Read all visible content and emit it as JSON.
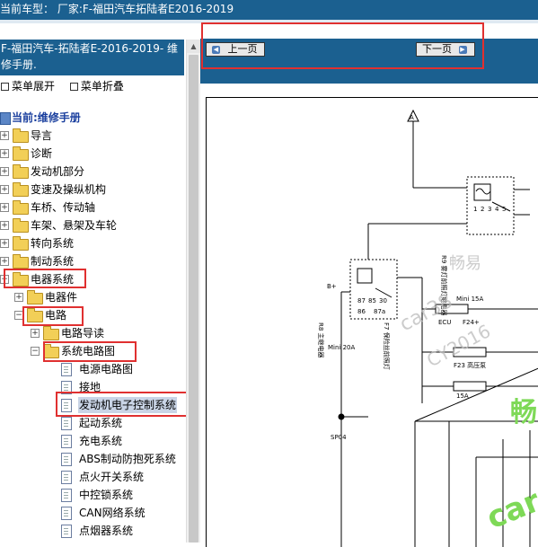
{
  "header": {
    "title": "当前车型：  厂家:F-福田汽车拓陆者E2016-2019"
  },
  "sidebar": {
    "book_title": "F-福田汽车-拓陆者E-2016-2019- 维修手册.",
    "expand_label": "菜单展开",
    "collapse_label": "菜单折叠",
    "current_label": "当前:维修手册",
    "items": [
      {
        "label": "导言"
      },
      {
        "label": "诊断"
      },
      {
        "label": "发动机部分"
      },
      {
        "label": "变速及操纵机构"
      },
      {
        "label": "车桥、传动轴"
      },
      {
        "label": "车架、悬架及车轮"
      },
      {
        "label": "转向系统"
      },
      {
        "label": "制动系统"
      },
      {
        "label": "电器系统"
      },
      {
        "label": "电器件"
      },
      {
        "label": "电路"
      },
      {
        "label": "电路导读"
      },
      {
        "label": "系统电路图"
      },
      {
        "label": "电源电路图"
      },
      {
        "label": "接地"
      },
      {
        "label": "发动机电子控制系统"
      },
      {
        "label": "起动系统"
      },
      {
        "label": "充电系统"
      },
      {
        "label": "ABS制动防抱死系统"
      },
      {
        "label": "点火开关系统"
      },
      {
        "label": "中控锁系统"
      },
      {
        "label": "CAN网络系统"
      },
      {
        "label": "点烟器系统"
      }
    ]
  },
  "nav": {
    "prev_label": "上一页",
    "next_label": "下一页"
  },
  "diagram": {
    "labels": {
      "r9": "R9 雾灯前照灯继电器",
      "relay2": "F7 保险丝前照灯",
      "rmain": "R8 主继电器",
      "mini20": "Mini 20A",
      "mini15a": "Mini 15A",
      "ecu": "ECU",
      "f23": "F23 高压泵",
      "f24": "F24+",
      "x15a": "15A",
      "sp04": "SP04",
      "bplus": "B+",
      "wm1": "畅易",
      "wm2": "car38",
      "wm3": "CY2016",
      "green1": "畅",
      "green2": "car",
      "term1": "1",
      "term2": "2",
      "term3": "3",
      "term4": "4",
      "term5": "5",
      "t87": "87",
      "t85": "85",
      "t86": "86",
      "t30": "30",
      "t87a": "87a",
      "bottom_a": "A"
    }
  },
  "colors": {
    "header_bg": "#1b6090",
    "highlight": "#e03030",
    "selected_bg": "#c9d4e6"
  }
}
